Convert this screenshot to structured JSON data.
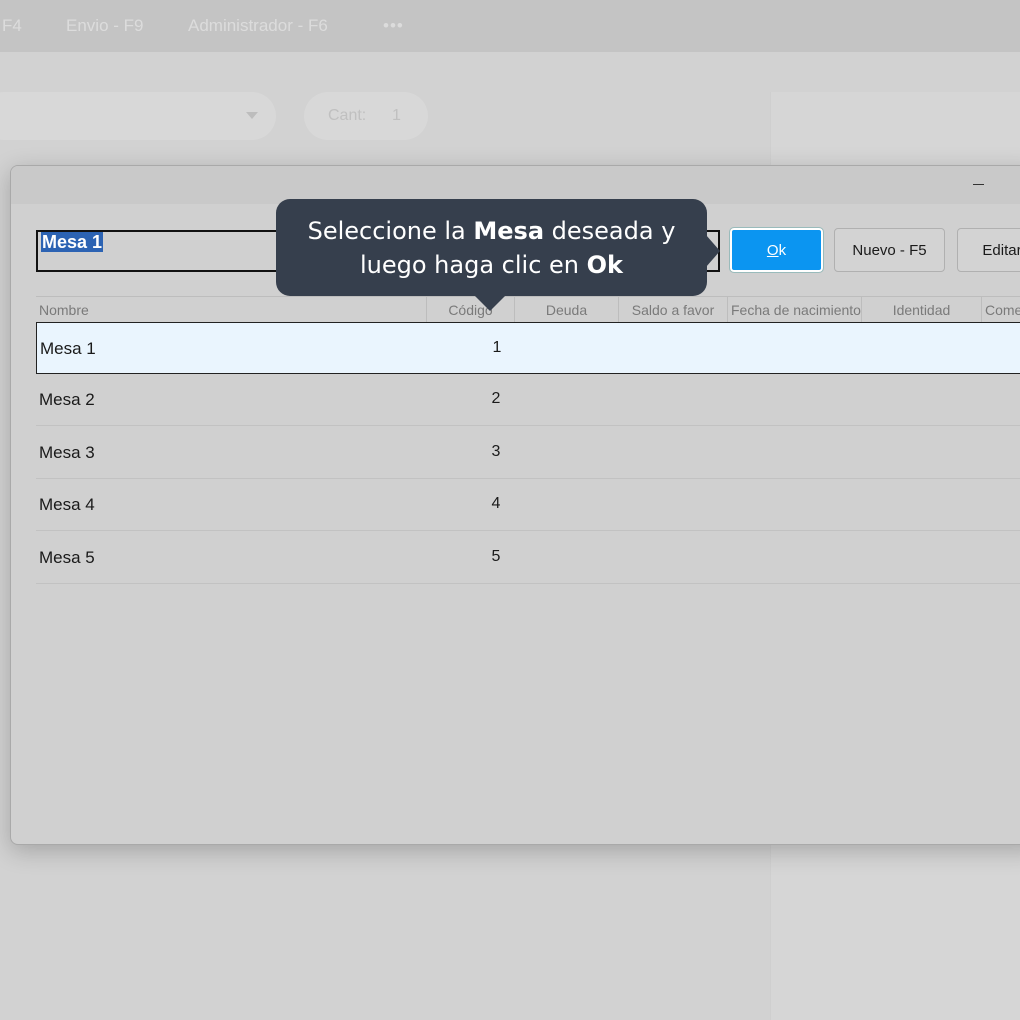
{
  "background_app": {
    "top_menu": [
      "F4",
      "Envio - F9",
      "Administrador - F6",
      "•••"
    ],
    "cant_label": "Cant:",
    "cant_value": "1"
  },
  "dialog": {
    "search_value": "Mesa 1",
    "buttons": {
      "ok_mnemonic": "O",
      "ok_rest": "k",
      "nuevo": "Nuevo - F5",
      "editar": "Editar"
    },
    "columns": [
      "Nombre",
      "Código",
      "Deuda",
      "Saldo a favor",
      "Fecha de nacimiento",
      "Identidad",
      "Comentario"
    ],
    "rows": [
      {
        "nombre": "Mesa 1",
        "codigo": "1",
        "selected": true
      },
      {
        "nombre": "Mesa 2",
        "codigo": "2",
        "selected": false
      },
      {
        "nombre": "Mesa 3",
        "codigo": "3",
        "selected": false
      },
      {
        "nombre": "Mesa 4",
        "codigo": "4",
        "selected": false
      },
      {
        "nombre": "Mesa 5",
        "codigo": "5",
        "selected": false
      }
    ]
  },
  "tooltip": {
    "line1_a": "Seleccione la ",
    "line1_b": "Mesa",
    "line1_c": " deseada y",
    "line2_a": "luego haga clic en ",
    "line2_b": "Ok"
  },
  "colors": {
    "ok_button": "#0b95f1",
    "tooltip_bg": "#363f4d",
    "selected_row": "#eaf5fe",
    "selection_highlight": "#2c63b3"
  }
}
